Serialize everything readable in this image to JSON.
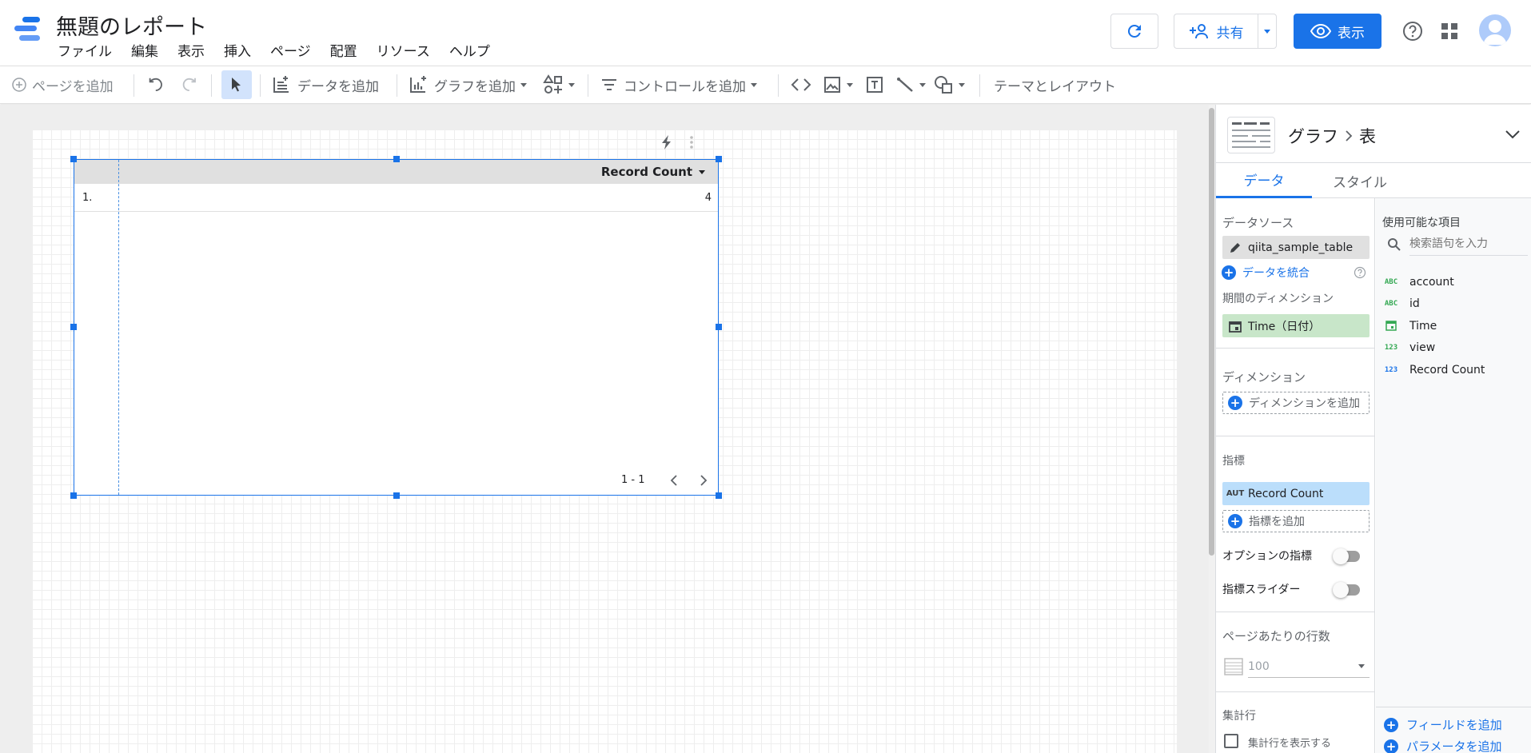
{
  "header": {
    "title": "無題のレポート",
    "menu": [
      "ファイル",
      "編集",
      "表示",
      "挿入",
      "ページ",
      "配置",
      "リソース",
      "ヘルプ"
    ],
    "share_label": "共有",
    "view_label": "表示"
  },
  "toolbar": {
    "add_page": "ページを追加",
    "add_data": "データを追加",
    "add_chart": "グラフを追加",
    "add_control": "コントロールを追加",
    "theme_layout": "テーマとレイアウト"
  },
  "table": {
    "metric_header": "Record Count",
    "rows": [
      {
        "index": "1.",
        "value": "4"
      }
    ],
    "pager": "1 - 1"
  },
  "panel": {
    "chart_label": "グラフ",
    "chart_type": "表",
    "tabs": {
      "data": "データ",
      "style": "スタイル"
    },
    "data_source_title": "データソース",
    "data_source": "qiita_sample_table",
    "blend_label": "データを統合",
    "date_dimension_title": "期間のディメンション",
    "date_dimension": "Time（日付）",
    "dimension_title": "ディメンション",
    "add_dimension": "ディメンションを追加",
    "metric_title": "指標",
    "metric_badge": "AUT",
    "metric": "Record Count",
    "add_metric": "指標を追加",
    "optional_metric": "オプションの指標",
    "metric_slider": "指標スライダー",
    "rows_per_page_title": "ページあたりの行数",
    "rows_per_page": "100",
    "summary_row_title": "集計行",
    "summary_row_check": "集計行を表示する"
  },
  "fields": {
    "title": "使用可能な項目",
    "search_placeholder": "検索語句を入力",
    "items": [
      {
        "type": "ABC",
        "name": "account"
      },
      {
        "type": "ABC",
        "name": "id"
      },
      {
        "type": "date",
        "name": "Time"
      },
      {
        "type": "123",
        "name": "view"
      },
      {
        "type": "123",
        "name": "Record Count"
      }
    ],
    "add_field": "フィールドを追加",
    "add_parameter": "パラメータを追加"
  },
  "colors": {
    "accent": "#1a73e8",
    "metric_chip": "#bbdefb",
    "dimension_chip": "#c8e6c9",
    "source_chip": "#e0e0e0"
  }
}
